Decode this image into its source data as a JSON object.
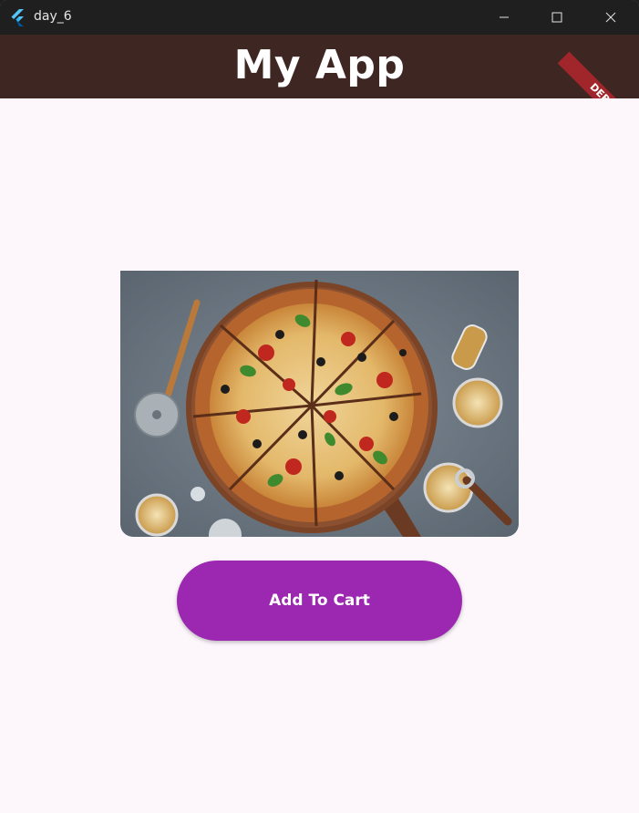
{
  "window": {
    "title": "day_6"
  },
  "appbar": {
    "title": "My App",
    "debug_label": "DEBUG"
  },
  "main": {
    "image_subject": "pizza",
    "add_to_cart_label": "Add To Cart"
  },
  "colors": {
    "titlebar": "#1f1f1f",
    "appbar": "#3e2623",
    "background": "#fdf7fc",
    "button": "#9c27b0",
    "debug_banner": "#a1262b"
  },
  "icons": [
    "flutter-icon",
    "minimize-icon",
    "maximize-icon",
    "close-icon"
  ]
}
